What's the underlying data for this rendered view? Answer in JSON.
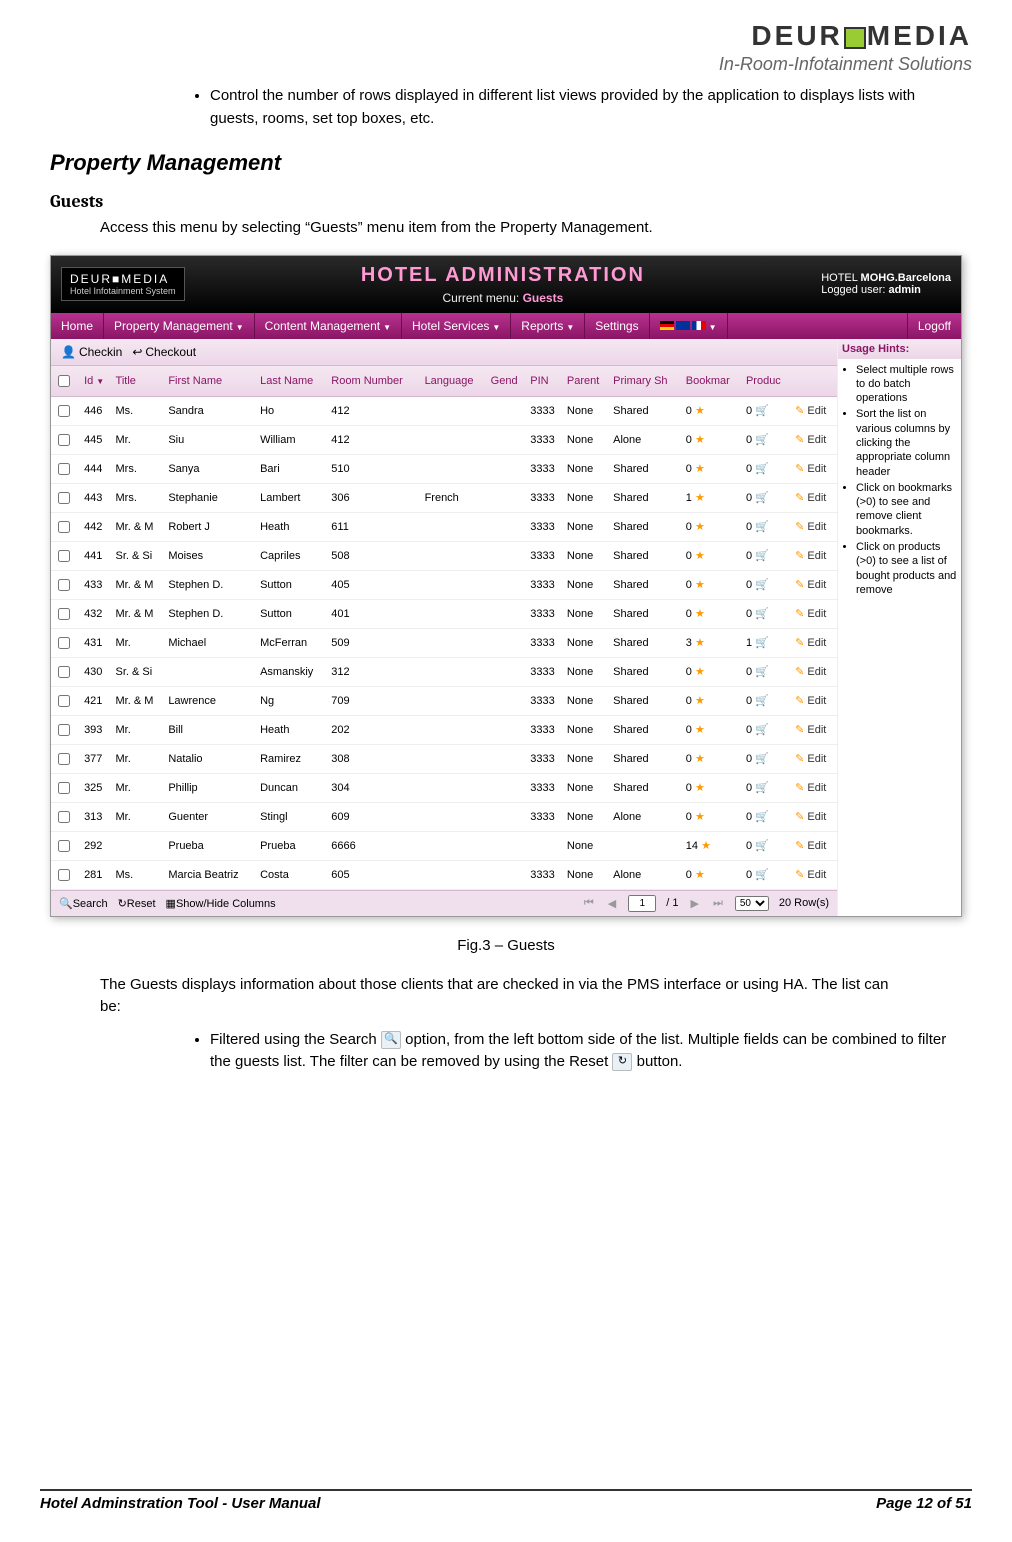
{
  "logo": {
    "brand": "DEUR",
    "brand2": "MEDIA",
    "sub": "In-Room-Infotainment Solutions"
  },
  "doc": {
    "bullet1": "Control the number of rows displayed in different list views provided by the application to displays lists with guests, rooms, set top boxes, etc.",
    "h2": "Property Management",
    "h3": "Guests",
    "intro": "Access this menu by selecting “Guests” menu item from the Property Management.",
    "fig": "Fig.3 – Guests",
    "para1": "The Guests displays information about those clients that are checked in via the PMS interface or using HA. The list can be:",
    "bullet2a": "Filtered using the Search ",
    "bullet2b": " option, from the left bottom side of the list. Multiple fields can be combined to filter the guests list. The filter can be removed by using the Reset ",
    "bullet2c": " button.",
    "footer_l": "Hotel Adminstration Tool - User Manual",
    "footer_r": "Page 12 of 51"
  },
  "app": {
    "logo": "DEUR■MEDIA",
    "logo_sub": "Hotel Infotainment System",
    "title": "HOTEL  ADMINISTRATION",
    "current_menu_label": "Current menu:",
    "current_menu": "Guests",
    "hotel_label": "HOTEL",
    "hotel": "MOHG.Barcelona",
    "user_label": "Logged user:",
    "user": "admin",
    "menu": [
      "Home",
      "Property Management",
      "Content Management",
      "Hotel Services",
      "Reports",
      "Settings"
    ],
    "logoff": "Logoff",
    "toolbar": {
      "checkin": "Checkin",
      "checkout": "Checkout"
    },
    "columns": [
      "",
      "Id",
      "Title",
      "First Name",
      "Last Name",
      "Room Number",
      "Language",
      "Gend",
      "PIN",
      "Parent",
      "Primary Sh",
      "Bookmar",
      "Produc",
      ""
    ],
    "rows": [
      [
        "446",
        "Ms.",
        "Sandra",
        "Ho",
        "412",
        "",
        "",
        "3333",
        "None",
        "Shared",
        "0",
        "0"
      ],
      [
        "445",
        "Mr.",
        "Siu",
        "William",
        "412",
        "",
        "",
        "3333",
        "None",
        "Alone",
        "0",
        "0"
      ],
      [
        "444",
        "Mrs.",
        "Sanya",
        "Bari",
        "510",
        "",
        "",
        "3333",
        "None",
        "Shared",
        "0",
        "0"
      ],
      [
        "443",
        "Mrs.",
        "Stephanie",
        "Lambert",
        "306",
        "French",
        "",
        "3333",
        "None",
        "Shared",
        "1",
        "0"
      ],
      [
        "442",
        "Mr. & M",
        "Robert J",
        "Heath",
        "611",
        "",
        "",
        "3333",
        "None",
        "Shared",
        "0",
        "0"
      ],
      [
        "441",
        "Sr. & Si",
        "Moises",
        "Capriles",
        "508",
        "",
        "",
        "3333",
        "None",
        "Shared",
        "0",
        "0"
      ],
      [
        "433",
        "Mr. & M",
        "Stephen D.",
        "Sutton",
        "405",
        "",
        "",
        "3333",
        "None",
        "Shared",
        "0",
        "0"
      ],
      [
        "432",
        "Mr. & M",
        "Stephen D.",
        "Sutton",
        "401",
        "",
        "",
        "3333",
        "None",
        "Shared",
        "0",
        "0"
      ],
      [
        "431",
        "Mr.",
        "Michael",
        "McFerran",
        "509",
        "",
        "",
        "3333",
        "None",
        "Shared",
        "3",
        "1"
      ],
      [
        "430",
        "Sr. & Si",
        "",
        "Asmanskiy",
        "312",
        "",
        "",
        "3333",
        "None",
        "Shared",
        "0",
        "0"
      ],
      [
        "421",
        "Mr. & M",
        "Lawrence",
        "Ng",
        "709",
        "",
        "",
        "3333",
        "None",
        "Shared",
        "0",
        "0"
      ],
      [
        "393",
        "Mr.",
        "Bill",
        "Heath",
        "202",
        "",
        "",
        "3333",
        "None",
        "Shared",
        "0",
        "0"
      ],
      [
        "377",
        "Mr.",
        "Natalio",
        "Ramirez",
        "308",
        "",
        "",
        "3333",
        "None",
        "Shared",
        "0",
        "0"
      ],
      [
        "325",
        "Mr.",
        "Phillip",
        "Duncan",
        "304",
        "",
        "",
        "3333",
        "None",
        "Shared",
        "0",
        "0"
      ],
      [
        "313",
        "Mr.",
        "Guenter",
        "Stingl",
        "609",
        "",
        "",
        "3333",
        "None",
        "Alone",
        "0",
        "0"
      ],
      [
        "292",
        "",
        "Prueba",
        "Prueba",
        "6666",
        "",
        "",
        "",
        "None",
        "",
        "14",
        "0"
      ],
      [
        "281",
        "Ms.",
        "Marcia Beatriz",
        "Costa",
        "605",
        "",
        "",
        "3333",
        "None",
        "Alone",
        "0",
        "0"
      ]
    ],
    "edit": "Edit",
    "footer": {
      "search": "Search",
      "reset": "Reset",
      "showhide": "Show/Hide Columns",
      "page": "1",
      "pages": "/ 1",
      "pagesize": "50",
      "rowcount": "20 Row(s)"
    },
    "hints_title": "Usage Hints:",
    "hints": [
      "Select multiple rows to do batch operations",
      "Sort the list on various columns by clicking the appropriate column header",
      "Click on bookmarks (>0) to see and remove client bookmarks.",
      "Click on products (>0) to see a list of bought products and remove"
    ]
  }
}
